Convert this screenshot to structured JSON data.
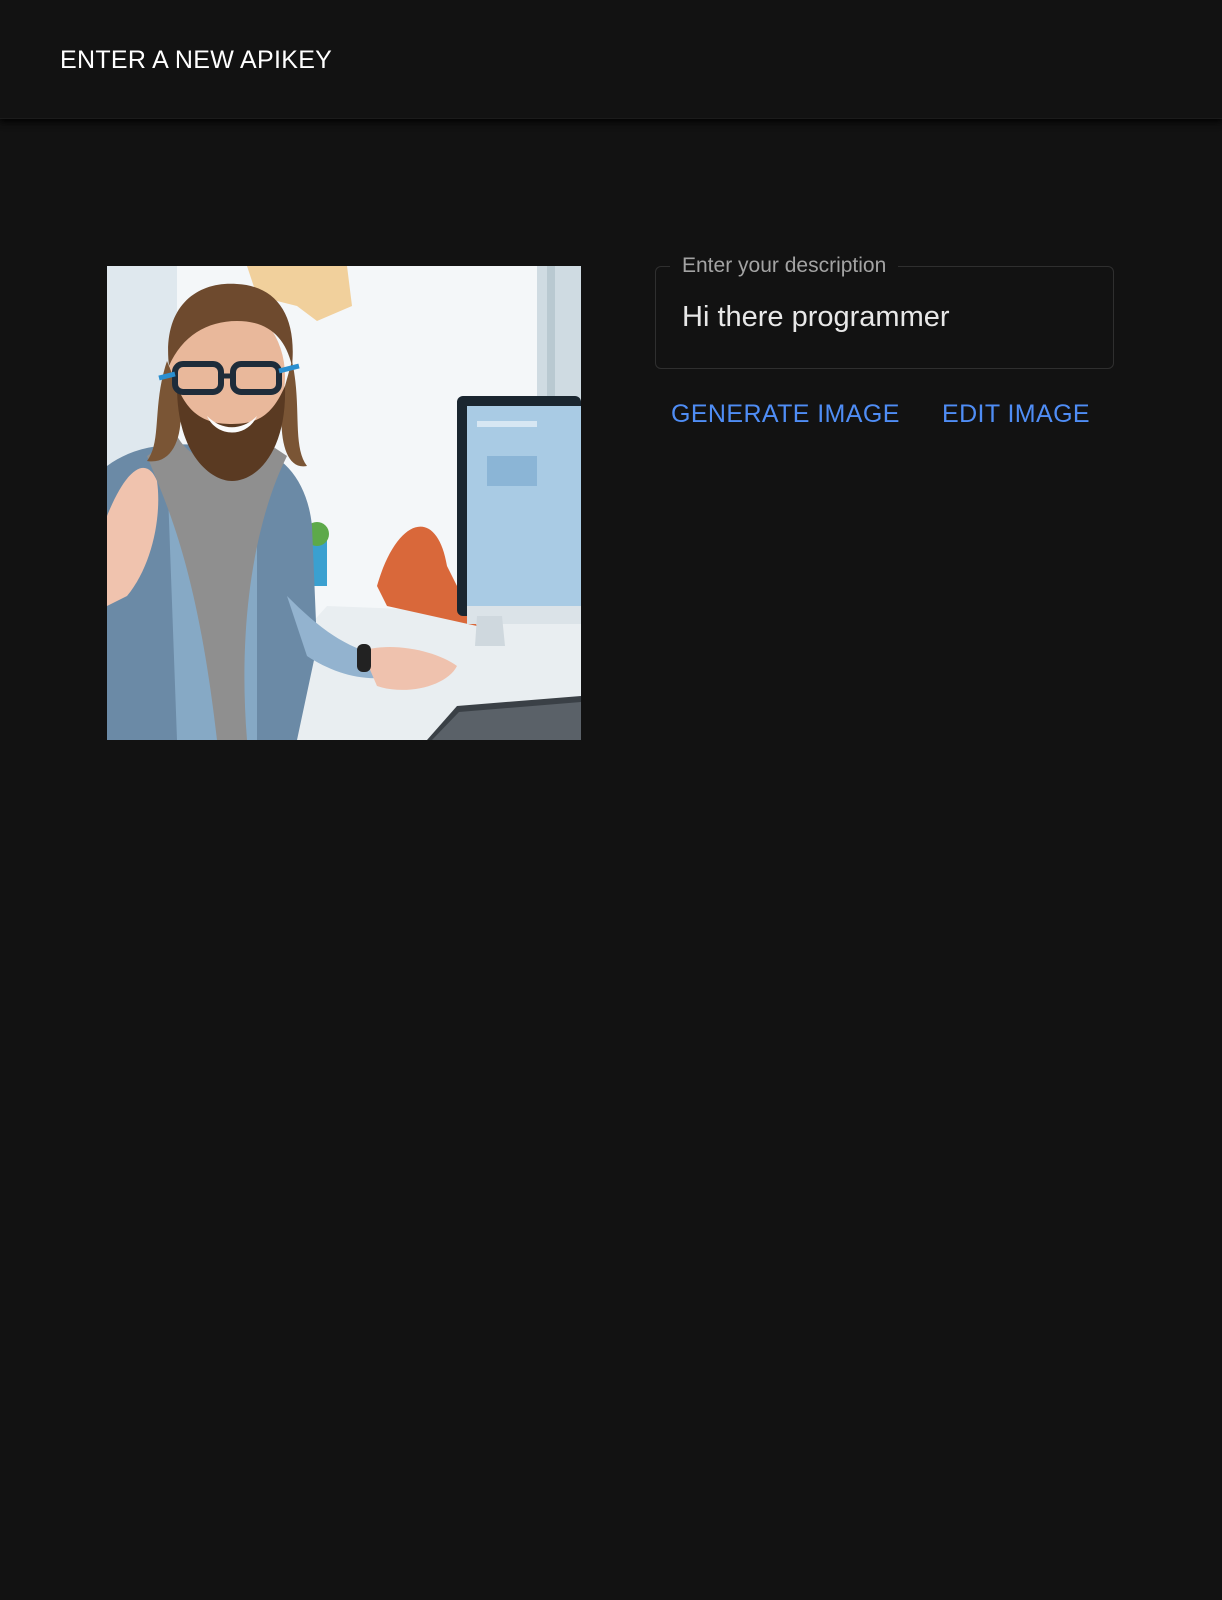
{
  "header": {
    "apikey_label": "ENTER A NEW APIKEY"
  },
  "preview": {
    "icon": "generated-image-preview"
  },
  "description": {
    "label": "Enter your description",
    "value": "Hi there programmer"
  },
  "actions": {
    "generate_label": "GENERATE IMAGE",
    "edit_label": "EDIT IMAGE"
  },
  "colors": {
    "background": "#121212",
    "accent": "#4f8df5",
    "label": "#a3a3a3"
  }
}
